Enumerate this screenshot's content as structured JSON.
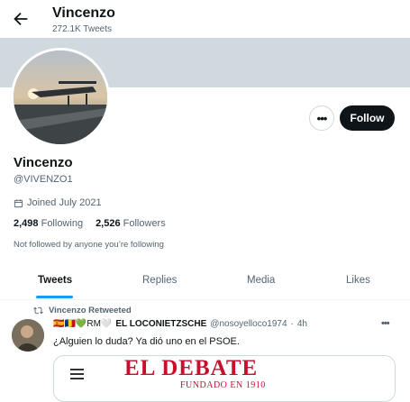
{
  "header": {
    "title": "Vincenzo",
    "tweet_count": "272.1K Tweets"
  },
  "profile": {
    "name": "Vincenzo",
    "handle": "@VIVENZO1",
    "joined": "Joined July 2021",
    "following_count": "2,498",
    "following_label": "Following",
    "followers_count": "2,526",
    "followers_label": "Followers",
    "not_followed": "Not followed by anyone you’re following",
    "follow_label": "Follow"
  },
  "tabs": [
    {
      "label": "Tweets",
      "active": true
    },
    {
      "label": "Replies",
      "active": false
    },
    {
      "label": "Media",
      "active": false
    },
    {
      "label": "Likes",
      "active": false
    }
  ],
  "tweet": {
    "retweet_label": "Vincenzo Retweeted",
    "flags": "🇪🇸🇷🇴💚RM🤍",
    "author_name": "EL LOCONIETZSCHE",
    "author_handle": "@nosoyelloco1974",
    "time": "4h",
    "text": "¿Alguien lo duda? Ya dió uno en el PSOE.",
    "card_brand": "EL DEBATE",
    "card_tagline": "FUNDADO EN 1910"
  },
  "colors": {
    "accent": "#1d9bf0",
    "brand_red": "#c8102e",
    "text": "#0f1419",
    "muted": "#536471"
  }
}
